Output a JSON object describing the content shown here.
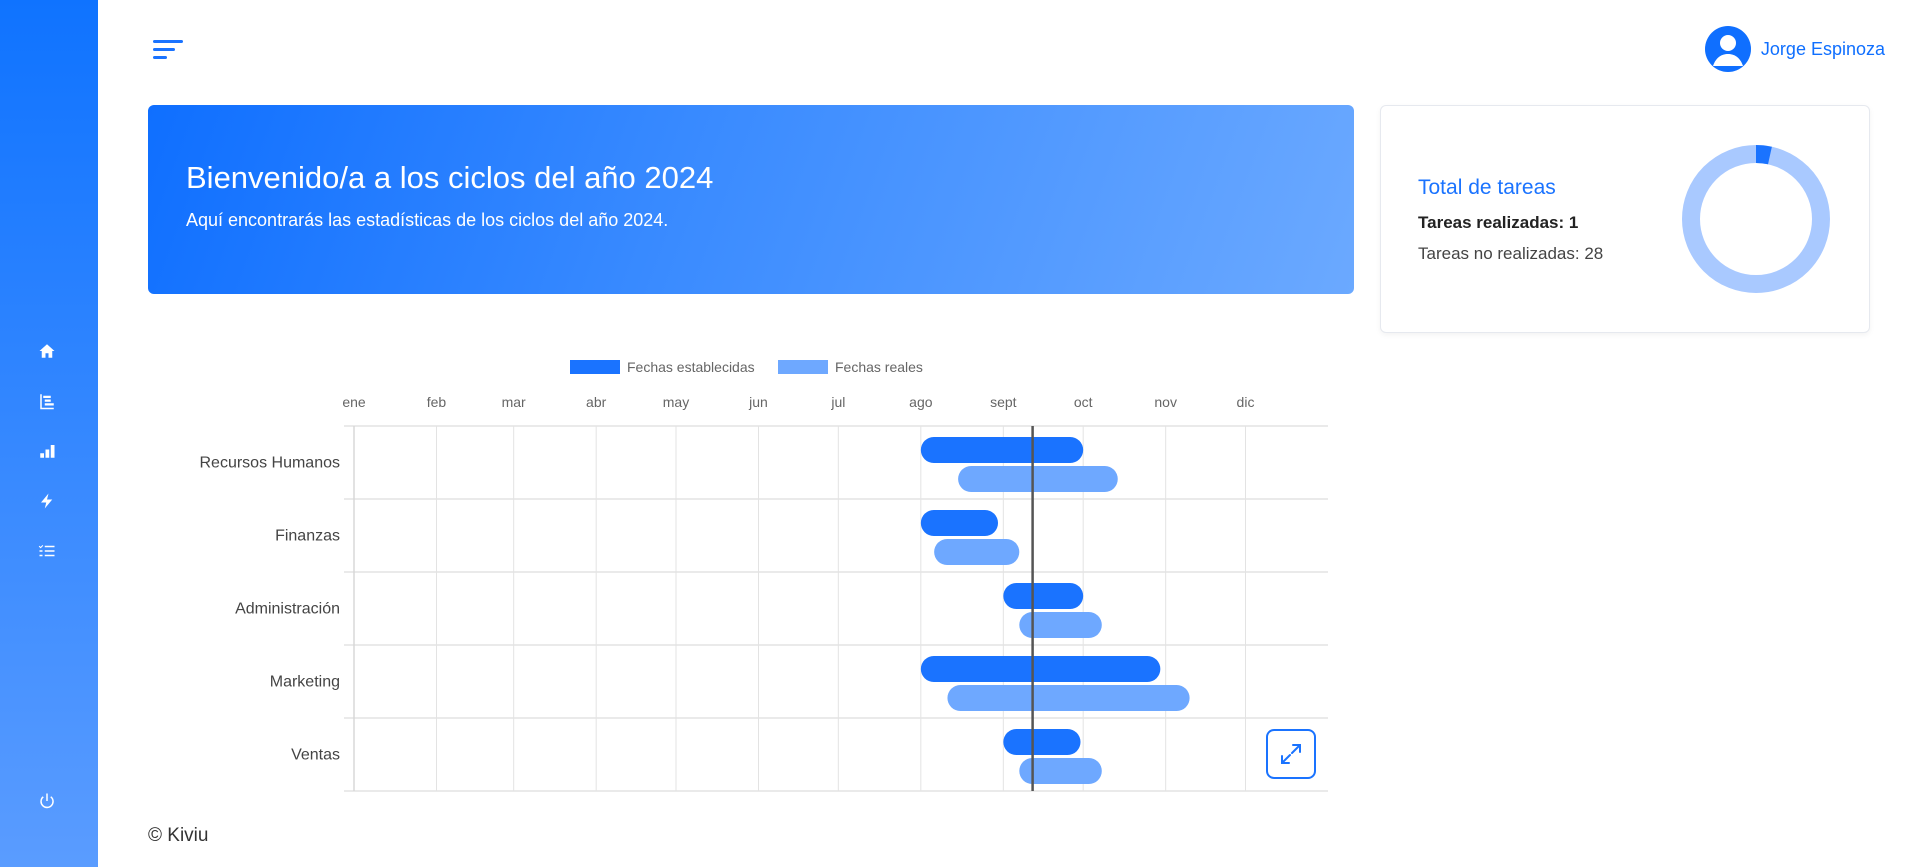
{
  "header": {
    "user_name": "Jorge Espinoza"
  },
  "sidebar": {
    "items": [
      {
        "name": "home-icon"
      },
      {
        "name": "hierarchy-icon"
      },
      {
        "name": "bar-chart-icon"
      },
      {
        "name": "bolt-icon"
      },
      {
        "name": "checklist-icon"
      }
    ],
    "logout_icon": "power-icon"
  },
  "banner": {
    "title": "Bienvenido/a a los ciclos del año 2024",
    "subtitle": "Aquí encontrarás las estadísticas de los ciclos del año 2024."
  },
  "tasks_card": {
    "title": "Total de tareas",
    "done_label": "Tareas realizadas: 1",
    "pending_label": "Tareas no realizadas: 28",
    "done": 1,
    "pending": 28
  },
  "colors": {
    "primary": "#1a73ff",
    "light": "#6ea8ff",
    "donut_light": "#a9c9ff"
  },
  "chart_data": {
    "type": "gantt",
    "legend": [
      "Fechas establecidas",
      "Fechas reales"
    ],
    "months": [
      "ene",
      "feb",
      "mar",
      "abr",
      "may",
      "jun",
      "jul",
      "ago",
      "sept",
      "oct",
      "nov",
      "dic"
    ],
    "categories": [
      "Recursos Humanos",
      "Finanzas",
      "Administración",
      "Marketing",
      "Ventas"
    ],
    "series": [
      {
        "name": "Fechas establecidas",
        "ranges": [
          [
            "2024-08-01",
            "2024-10-01"
          ],
          [
            "2024-08-01",
            "2024-08-30"
          ],
          [
            "2024-09-01",
            "2024-10-01"
          ],
          [
            "2024-08-01",
            "2024-10-30"
          ],
          [
            "2024-09-01",
            "2024-09-30"
          ]
        ]
      },
      {
        "name": "Fechas reales",
        "ranges": [
          [
            "2024-08-15",
            "2024-10-14"
          ],
          [
            "2024-08-06",
            "2024-09-07"
          ],
          [
            "2024-09-07",
            "2024-10-08"
          ],
          [
            "2024-08-11",
            "2024-11-10"
          ],
          [
            "2024-09-07",
            "2024-10-08"
          ]
        ]
      }
    ],
    "today": "2024-09-12"
  },
  "footer": {
    "text": "© Kiviu"
  }
}
